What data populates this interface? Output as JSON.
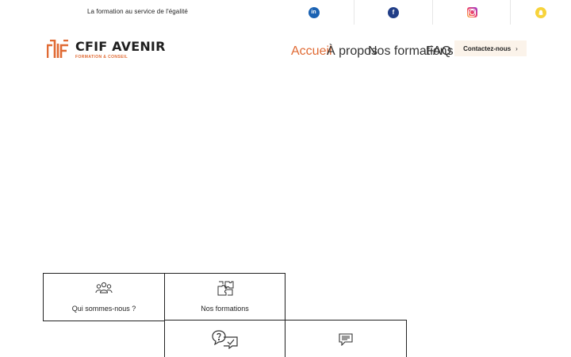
{
  "topbar": {
    "tagline": "La formation au service de l'égalité",
    "socials": [
      {
        "name": "linkedin-icon",
        "glyph": "in",
        "color": "#1a62b3"
      },
      {
        "name": "facebook-icon",
        "glyph": "f",
        "color": "#213e87"
      },
      {
        "name": "instagram-icon",
        "glyph": "",
        "color": "#ef4565"
      },
      {
        "name": "snapchat-icon",
        "glyph": "",
        "color": "#f7d33b"
      }
    ]
  },
  "brand": {
    "name": "CFIF AVENIR",
    "subtitle": "FORMATION & CONSEIL",
    "accent": "#e06a33"
  },
  "nav": {
    "items": [
      {
        "label": "Accueil",
        "active": true
      },
      {
        "label": "À propos",
        "active": false
      },
      {
        "label": "Nos formations",
        "active": false
      },
      {
        "label": "FAQ",
        "active": false
      }
    ],
    "cta_label": "Contactez-nous",
    "cta_chevron": "›"
  },
  "cards": [
    {
      "label": "Qui sommes-nous ?",
      "icon": "team-icon"
    },
    {
      "label": "Nos formations",
      "icon": "puzzle-icon"
    },
    {
      "label": "",
      "icon": "question-chat-icon"
    },
    {
      "label": "",
      "icon": "message-icon"
    }
  ]
}
